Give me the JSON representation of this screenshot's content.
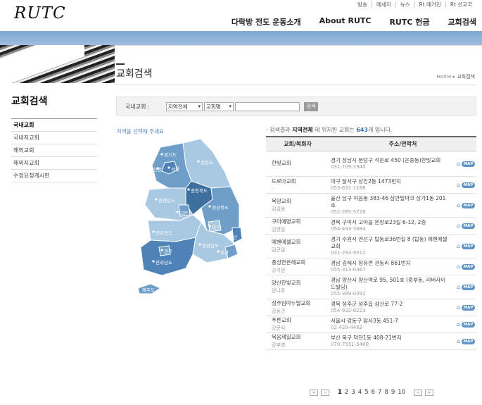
{
  "header": {
    "logo": "RUTC",
    "util_links": [
      "방송",
      "메세지",
      "뉴스",
      "Rt 매거진",
      "Rt 선교국"
    ],
    "nav": [
      "다락방 전도 운동소개",
      "About RUTC",
      "RUTC 헌금",
      "교회검색"
    ]
  },
  "page": {
    "title": "교회검색",
    "breadcrumb": [
      "Home",
      "교회검색"
    ]
  },
  "sidebar": {
    "title": "교회검색",
    "items": [
      {
        "label": "국내교회",
        "active": true
      },
      {
        "label": "국내지교회",
        "active": false
      },
      {
        "label": "해외교회",
        "active": false
      },
      {
        "label": "해외지교회",
        "active": false
      },
      {
        "label": "수정요청게시판",
        "active": false
      }
    ]
  },
  "search": {
    "label": "국내교회 :",
    "region_select": "지역전체",
    "field_select": "교회명",
    "input_value": "",
    "button": "검색"
  },
  "map": {
    "hint": "지역을 선택해 주세요",
    "regions": [
      "경기도",
      "인천",
      "서울",
      "강원도",
      "충청북도",
      "충청남도",
      "대전",
      "경상북도",
      "대구",
      "전라북도",
      "울산",
      "광주",
      "경상남도",
      "부산",
      "전라남도",
      "제주도"
    ]
  },
  "results": {
    "summary_prefix": "검색결과",
    "summary_region": "지역전체",
    "summary_middle": "에 위치한 교회는",
    "summary_count": "643",
    "summary_suffix": "개 입니다.",
    "col_name": "교회/목회자",
    "col_addr": "주소/연락처",
    "map_label": "MAP",
    "rows": [
      {
        "name": "한빛교회",
        "pastor": "",
        "addr": "경기 성남시 분당구 석운로 450 (운중동)한빛교회",
        "tel": "031-709-1940"
      },
      {
        "name": "드로아교회",
        "pastor": "-",
        "addr": "대구 달서구 상인2동 1473번지",
        "tel": "053-631-1188"
      },
      {
        "name": "목양교회",
        "pastor": "김길용",
        "addr": "울산 남구 야음동 383-46 삼안빌파크 상가1동 201호",
        "tel": "052-265-5726"
      },
      {
        "name": "구미예명교회",
        "pastor": "김영일",
        "addr": "경북 구미시 고아읍 문장로23길 6-12, 2층",
        "tel": "054-443-5684"
      },
      {
        "name": "에벤에셀교회",
        "pastor": "김군일",
        "addr": "경기 수원시 권선구 탑동로36번길 8 (탑동) 에벤에셀교회",
        "tel": "031-293-9512"
      },
      {
        "name": "풍성한은혜교회",
        "pastor": "강기원",
        "addr": "경남 김해시 장유면 관동리 861번지",
        "tel": "055-313-0467"
      },
      {
        "name": "양산한빛교회",
        "pastor": "강나루",
        "addr": "경남 양산시 양산역로 95, 501호 (중부동, 리버사이드빌딩)",
        "tel": "055-389-0391"
      },
      {
        "name": "성주임마누엘교회",
        "pastor": "강동관",
        "addr": "경북 성주군 성주읍 삼산로 77-2",
        "tel": "054-932-8223"
      },
      {
        "name": "푸른교회",
        "pastor": "강문식",
        "addr": "서울시 강동구 암사3동 451-7",
        "tel": "02-429-4463"
      },
      {
        "name": "복음제일교회",
        "pastor": "강부영",
        "addr": "부산 북구 덕천1동 408-21번지",
        "tel": "070-7551-5468"
      }
    ]
  },
  "pager": {
    "pages": [
      "1",
      "2",
      "3",
      "4",
      "5",
      "6",
      "7",
      "8",
      "9",
      "10"
    ],
    "current": "1",
    "first": "«",
    "prev": "‹",
    "next": "›",
    "last": "»"
  }
}
